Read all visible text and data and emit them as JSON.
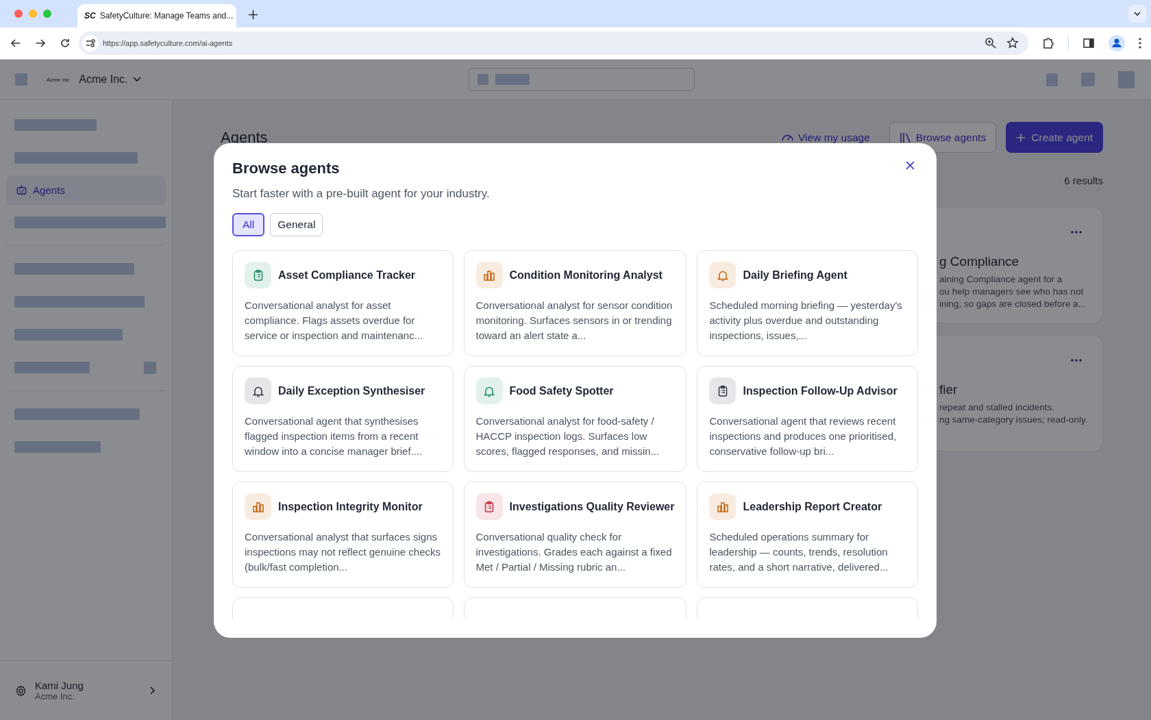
{
  "browser": {
    "tab": {
      "logo": "SC",
      "title": "SafetyCulture: Manage Teams and..."
    },
    "url": "https://app.safetyculture.com/ai-agents"
  },
  "header": {
    "org_logo": "Acme Inc",
    "org_name": "Acme Inc."
  },
  "sidebar": {
    "items": [
      {
        "label": "Agents",
        "selected": true
      }
    ],
    "user": {
      "name": "Kami Jung",
      "org": "Acme Inc."
    }
  },
  "page": {
    "title": "Agents",
    "actions": [
      {
        "kind": "link",
        "label": "View my usage"
      },
      {
        "kind": "secondary",
        "label": "Browse agents"
      },
      {
        "kind": "primary",
        "label": "Create agent"
      }
    ],
    "results": "6 results",
    "cards": [
      {
        "title": "g Compliance",
        "lines": [
          "aining Compliance agent for a",
          "ou help managers see who has not",
          "ining, so gaps are closed before a..."
        ]
      },
      {
        "title": "fier",
        "lines": [
          "repeat and stalled incidents.",
          "ng same-category issues; read-only."
        ]
      }
    ]
  },
  "modal": {
    "title": "Browse agents",
    "subtitle": "Start faster with a pre-built agent for your industry.",
    "filters": [
      {
        "label": "All",
        "selected": true
      },
      {
        "label": "General",
        "selected": false
      }
    ],
    "agents": [
      {
        "title": "Asset Compliance Tracker",
        "description": "Conversational analyst for asset compliance. Flags assets overdue for service or inspection and maintenanc...",
        "kind": "clipboard",
        "color": "#1a8a5c"
      },
      {
        "title": "Condition Monitoring Analyst",
        "description": "Conversational analyst for sensor condition monitoring. Surfaces sensors in or trending toward an alert state a...",
        "kind": "chart",
        "color": "#c2620a"
      },
      {
        "title": "Daily Briefing Agent",
        "description": "Scheduled morning briefing — yesterday's activity plus overdue and outstanding inspections, issues,...",
        "kind": "bell",
        "color": "#c2620a"
      },
      {
        "title": "Daily Exception Synthesiser",
        "description": "Conversational agent that synthesises flagged inspection items from a recent window into a concise manager brief....",
        "kind": "bell",
        "color": "#2e3440"
      },
      {
        "title": "Food Safety Spotter",
        "description": "Conversational analyst for food-safety / HACCP inspection logs. Surfaces low scores, flagged responses, and missin...",
        "kind": "bell",
        "color": "#1a8a5c"
      },
      {
        "title": "Inspection Follow-Up Advisor",
        "description": "Conversational agent that reviews recent inspections and produces one prioritised, conservative follow-up bri...",
        "kind": "clipboard",
        "color": "#2e3440"
      },
      {
        "title": "Inspection Integrity Monitor",
        "description": "Conversational analyst that surfaces signs inspections may not reflect genuine checks (bulk/fast completion...",
        "kind": "chart",
        "color": "#c2620a"
      },
      {
        "title": "Investigations Quality Reviewer",
        "description": "Conversational quality check for investigations. Grades each against a fixed Met / Partial / Missing rubric an...",
        "kind": "clipboard",
        "color": "#c0283a"
      },
      {
        "title": "Leadership Report Creator",
        "description": "Scheduled operations summary for leadership — counts, trends, resolution rates, and a short narrative, delivered...",
        "kind": "chart",
        "color": "#c2620a"
      }
    ]
  }
}
